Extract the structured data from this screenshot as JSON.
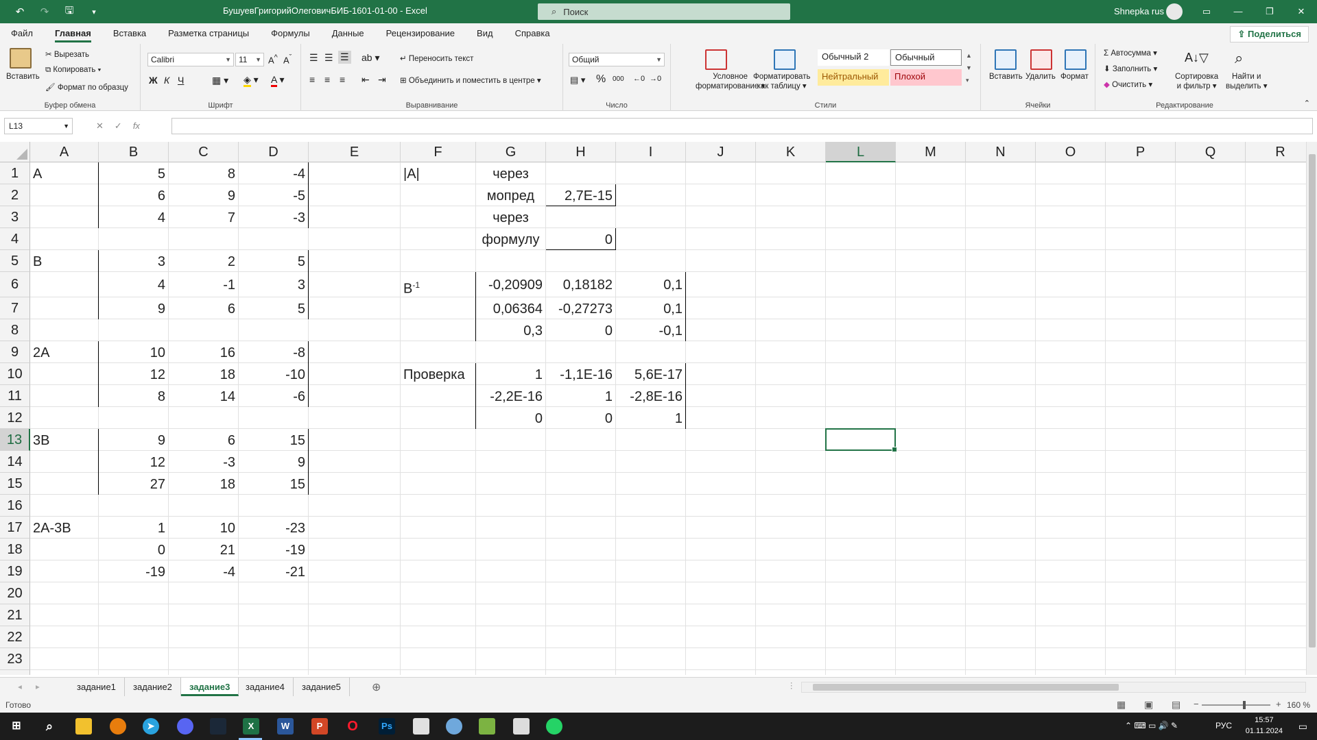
{
  "window": {
    "title": "БушуевГригорийОлеговичБИБ-1601-01-00  -  Excel",
    "search_placeholder": "Поиск",
    "user": "Shnepka rus",
    "accent": "#217346"
  },
  "menu": {
    "tabs": [
      "Файл",
      "Главная",
      "Вставка",
      "Разметка страницы",
      "Формулы",
      "Данные",
      "Рецензирование",
      "Вид",
      "Справка"
    ],
    "active": "Главная",
    "share_label": "Поделиться"
  },
  "ribbon": {
    "clipboard": {
      "paste": "Вставить",
      "cut": "Вырезать",
      "copy": "Копировать",
      "format_painter": "Формат по образцу",
      "label": "Буфер обмена"
    },
    "font": {
      "name": "Calibri",
      "size": "11",
      "bold": "Ж",
      "italic": "К",
      "underline": "Ч",
      "label": "Шрифт"
    },
    "alignment": {
      "wrap": "Переносить текст",
      "merge": "Объединить и поместить в центре",
      "label": "Выравнивание"
    },
    "number": {
      "format": "Общий",
      "percent": "%",
      "thousands": "000",
      "label": "Число"
    },
    "styles": {
      "conditional": "Условное",
      "conditional2": "форматирование",
      "as_table": "Форматировать",
      "as_table2": "как таблицу",
      "normal2": "Обычный 2",
      "normal": "Обычный",
      "neutral": "Нейтральный",
      "bad": "Плохой",
      "label": "Стили"
    },
    "cells": {
      "insert": "Вставить",
      "delete": "Удалить",
      "format": "Формат",
      "label": "Ячейки"
    },
    "editing": {
      "autosum": "Автосумма",
      "fill": "Заполнить",
      "clear": "Очистить",
      "sort": "Сортировка",
      "sort2": "и фильтр",
      "find": "Найти и",
      "find2": "выделить",
      "label": "Редактирование"
    }
  },
  "formula_bar": {
    "name_box": "L13",
    "fx": "fx",
    "value": ""
  },
  "grid": {
    "columns": [
      "A",
      "B",
      "C",
      "D",
      "E",
      "F",
      "G",
      "H",
      "I",
      "J",
      "K",
      "L",
      "M",
      "N",
      "O",
      "P",
      "Q",
      "R"
    ],
    "rows": [
      "1",
      "2",
      "3",
      "4",
      "5",
      "6",
      "7",
      "8",
      "9",
      "10",
      "11",
      "12",
      "13",
      "14",
      "15",
      "16",
      "17",
      "18",
      "19",
      "20",
      "21",
      "22",
      "23",
      "24"
    ],
    "selected_cell": "L13",
    "cells": {
      "A1": "A",
      "B1": "5",
      "C1": "8",
      "D1": "-4",
      "F1": "|A|",
      "G1": "через",
      "B2": "6",
      "C2": "9",
      "D2": "-5",
      "G2": "мопред",
      "H2": "2,7E-15",
      "B3": "4",
      "C3": "7",
      "D3": "-3",
      "G3": "через",
      "G4": "формулу",
      "H4": "0",
      "A5": "B",
      "B5": "3",
      "C5": "2",
      "D5": "5",
      "B6": "4",
      "C6": "-1",
      "D6": "3",
      "F6": "B",
      "F6sup": "-1",
      "G6": "-0,20909",
      "H6": "0,18182",
      "I6": "0,1",
      "B7": "9",
      "C7": "6",
      "D7": "5",
      "G7": "0,06364",
      "H7": "-0,27273",
      "I7": "0,1",
      "G8": "0,3",
      "H8": "0",
      "I8": "-0,1",
      "A9": "2A",
      "B9": "10",
      "C9": "16",
      "D9": "-8",
      "B10": "12",
      "C10": "18",
      "D10": "-10",
      "F10": "Проверка",
      "G10": "1",
      "H10": "-1,1E-16",
      "I10": "5,6E-17",
      "B11": "8",
      "C11": "14",
      "D11": "-6",
      "G11": "-2,2E-16",
      "H11": "1",
      "I11": "-2,8E-16",
      "G12": "0",
      "H12": "0",
      "I12": "1",
      "A13": "3B",
      "B13": "9",
      "C13": "6",
      "D13": "15",
      "B14": "12",
      "C14": "-3",
      "D14": "9",
      "B15": "27",
      "C15": "18",
      "D15": "15",
      "A17": "2A-3B",
      "B17": "1",
      "C17": "10",
      "D17": "-23",
      "B18": "0",
      "C18": "21",
      "D18": "-19",
      "B19": "-19",
      "C19": "-4",
      "D19": "-21"
    }
  },
  "sheets": {
    "tabs": [
      "задание1",
      "задание2",
      "задание3",
      "задание4",
      "задание5"
    ],
    "active": "задание3"
  },
  "status": {
    "text": "Готово",
    "zoom": "160 %"
  },
  "taskbar": {
    "lang": "РУС",
    "time": "15:57",
    "date": "01.11.2024"
  }
}
